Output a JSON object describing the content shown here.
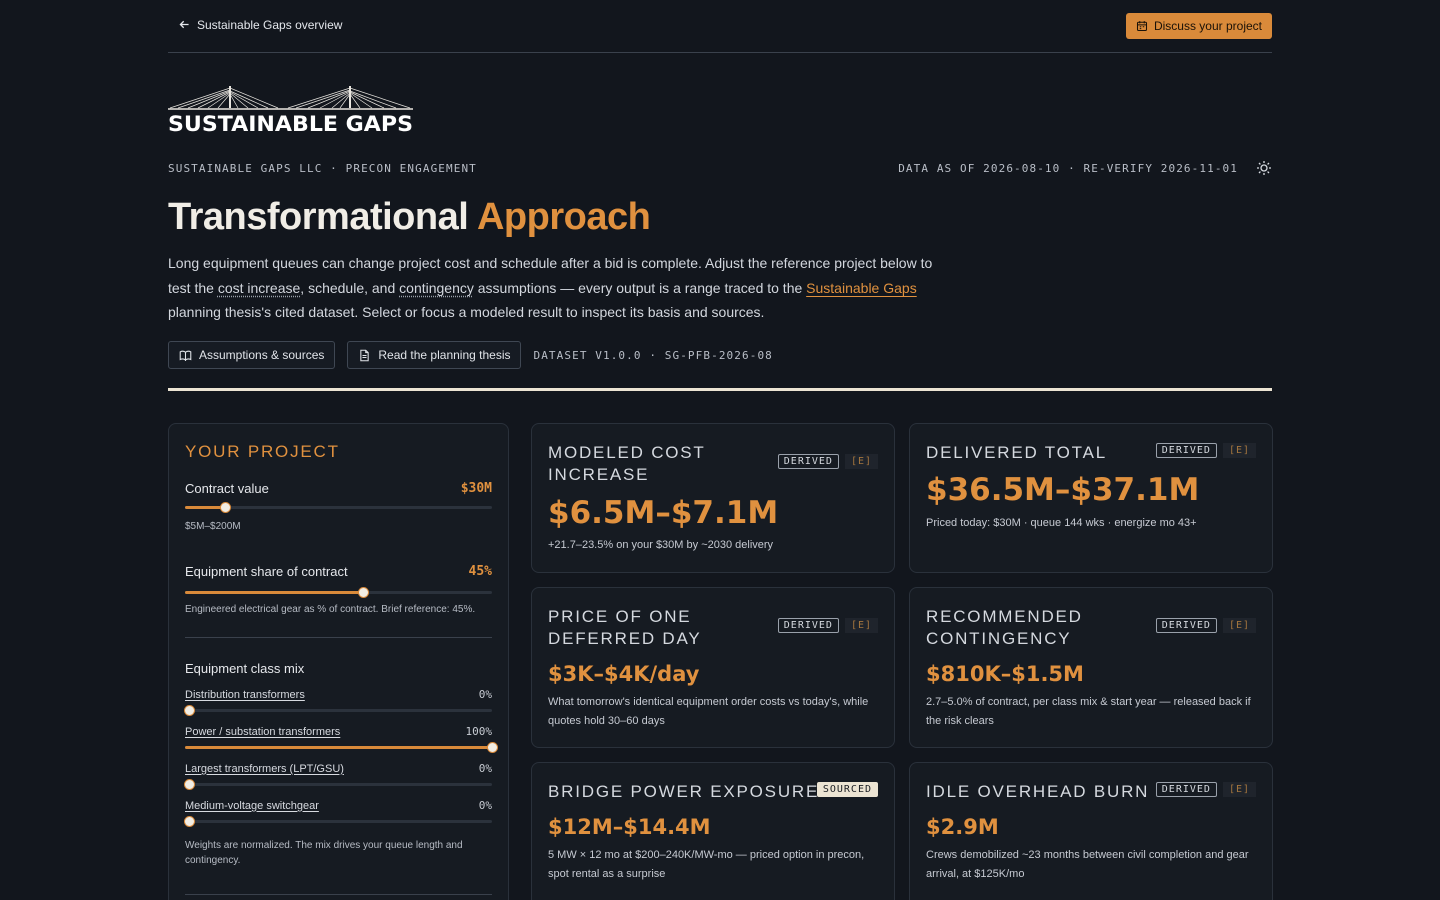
{
  "nav": {
    "back_label": "Sustainable Gaps overview",
    "cta_label": "Discuss your project"
  },
  "brand": {
    "logo_text": "SUSTAINABLE GAPS",
    "org_line": "SUSTAINABLE GAPS LLC · PRECON ENGAGEMENT",
    "data_line": "DATA AS OF 2026-08-10 · RE-VERIFY 2026-11-01"
  },
  "hero": {
    "title_main": "Transformational",
    "title_accent": "Approach",
    "lede_1": "Long equipment queues can change project cost and schedule after a bid is complete. Adjust the reference project below to test the ",
    "lede_term1": "cost increase",
    "lede_2": ", schedule, and ",
    "lede_term2": "contingency",
    "lede_3": " assumptions — every output is a range traced to the ",
    "lede_link": "Sustainable Gaps",
    "lede_4": " planning thesis's cited dataset. Select or focus a modeled result to inspect its basis and sources.",
    "btn_assumptions": "Assumptions & sources",
    "btn_thesis": "Read the planning thesis",
    "dataset": "DATASET V1.0.0 · SG-PFB-2026-08"
  },
  "project": {
    "title": "YOUR PROJECT",
    "contract_label": "Contract value",
    "contract_value": "$30M",
    "contract_fraction": 0.13,
    "contract_range": "$5M–$200M",
    "equipment_label": "Equipment share of contract",
    "equipment_value": "45%",
    "equipment_fraction": 0.58,
    "equipment_hint": "Engineered electrical gear as % of contract. Brief reference: 45%.",
    "mix_title": "Equipment class mix",
    "mix": [
      {
        "label": "Distribution transformers",
        "value": "0%",
        "fraction": 0
      },
      {
        "label": "Power / substation transformers",
        "value": "100%",
        "fraction": 1
      },
      {
        "label": "Largest transformers (LPT/GSU)",
        "value": "0%",
        "fraction": 0
      },
      {
        "label": "Medium-voltage switchgear",
        "value": "0%",
        "fraction": 0
      }
    ],
    "mix_note": "Weights are normalized. The mix drives your queue length and contingency."
  },
  "cards": {
    "derived": "DERIVED",
    "sourced": "SOURCED",
    "e": "[E]",
    "cost": {
      "title": "MODELED COST INCREASE",
      "value": "$6.5M–$7.1M",
      "note": "+21.7–23.5% on your $30M by ~2030 delivery"
    },
    "total": {
      "title": "DELIVERED TOTAL",
      "value": "$36.5M–$37.1M",
      "note": "Priced today: $30M · queue 144 wks · energize mo 43+"
    },
    "day": {
      "title": "PRICE OF ONE DEFERRED DAY",
      "value": "$3K–$4K/day",
      "note": "What tomorrow's identical equipment order costs vs today's, while quotes hold 30–60 days"
    },
    "contingency": {
      "title": "RECOMMENDED CONTINGENCY",
      "value": "$810K–$1.5M",
      "note": "2.7–5.0% of contract, per class mix & start year — released back if the risk clears"
    },
    "bridge": {
      "title": "BRIDGE POWER EXPOSURE",
      "value": "$12M–$14.4M",
      "note": "5 MW × 12 mo at $200–240K/MW-mo — priced option in precon, spot rental as a surprise"
    },
    "idle": {
      "title": "IDLE OVERHEAD BURN",
      "value": "$2.9M",
      "note": "Crews demobilized ~23 months between civil completion and gear arrival, at $125K/mo"
    }
  }
}
